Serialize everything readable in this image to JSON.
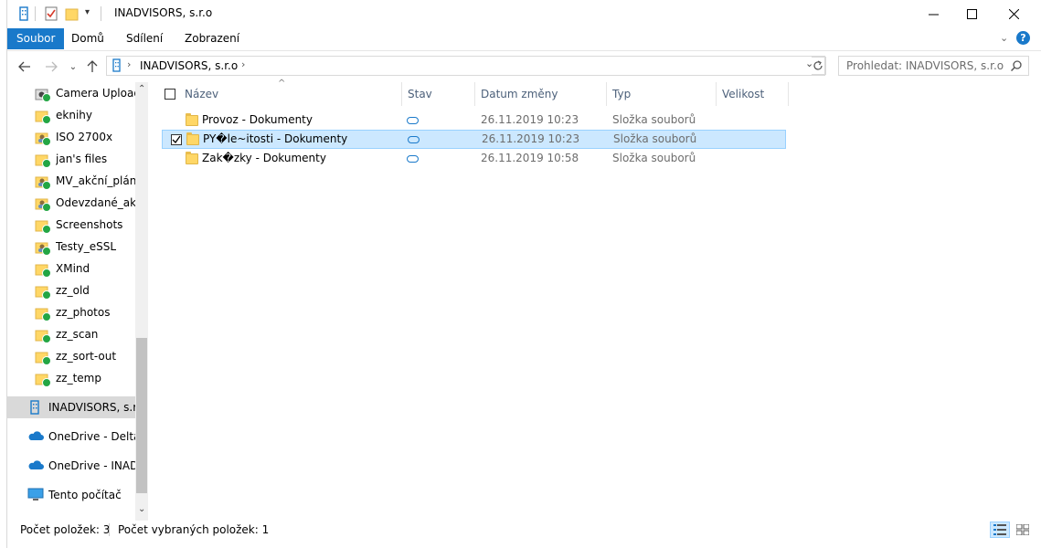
{
  "window": {
    "title": "INADVISORS, s.r.o"
  },
  "ribbon": {
    "tabs": [
      "Soubor",
      "Domů",
      "Sdílení",
      "Zobrazení"
    ]
  },
  "address": {
    "path": "INADVISORS, s.r.o",
    "search_placeholder": "Prohledat: INADVISORS, s.r.o"
  },
  "nav": {
    "items": [
      {
        "label": "Camera Uploads",
        "icon": "camera-folder-icon"
      },
      {
        "label": "eknihy",
        "icon": "folder-synced-icon"
      },
      {
        "label": "ISO 2700x",
        "icon": "shared-folder-icon"
      },
      {
        "label": "jan's files",
        "icon": "folder-synced-icon"
      },
      {
        "label": "MV_akční_plány",
        "icon": "shared-folder-icon"
      },
      {
        "label": "Odevzdané_akčr",
        "icon": "shared-folder-icon"
      },
      {
        "label": "Screenshots",
        "icon": "folder-synced-icon"
      },
      {
        "label": "Testy_eSSL",
        "icon": "shared-folder-icon"
      },
      {
        "label": "XMind",
        "icon": "folder-synced-icon"
      },
      {
        "label": "zz_old",
        "icon": "folder-synced-icon"
      },
      {
        "label": "zz_photos",
        "icon": "folder-synced-icon"
      },
      {
        "label": "zz_scan",
        "icon": "folder-synced-icon"
      },
      {
        "label": "zz_sort-out",
        "icon": "folder-synced-icon"
      },
      {
        "label": "zz_temp",
        "icon": "folder-synced-icon"
      }
    ],
    "roots": [
      {
        "label": "INADVISORS, s.r.o",
        "icon": "building-icon"
      },
      {
        "label": "OneDrive - Delta a",
        "icon": "onedrive-icon"
      },
      {
        "label": "OneDrive - INADV",
        "icon": "onedrive-icon"
      },
      {
        "label": "Tento počítač",
        "icon": "computer-icon"
      }
    ]
  },
  "columns": {
    "name": "Název",
    "status": "Stav",
    "date": "Datum změny",
    "type": "Typ",
    "size": "Velikost"
  },
  "files": [
    {
      "name": "Provoz - Dokumenty",
      "date": "26.11.2019 10:23",
      "type": "Složka souborů",
      "selected": false
    },
    {
      "name": "PY�le~itosti - Dokumenty",
      "date": "26.11.2019 10:23",
      "type": "Složka souborů",
      "selected": true
    },
    {
      "name": "Zak�zky - Dokumenty",
      "date": "26.11.2019 10:58",
      "type": "Složka souborů",
      "selected": false
    }
  ],
  "status": {
    "count": "Počet položek: 3",
    "selected": "Počet vybraných položek: 1"
  }
}
